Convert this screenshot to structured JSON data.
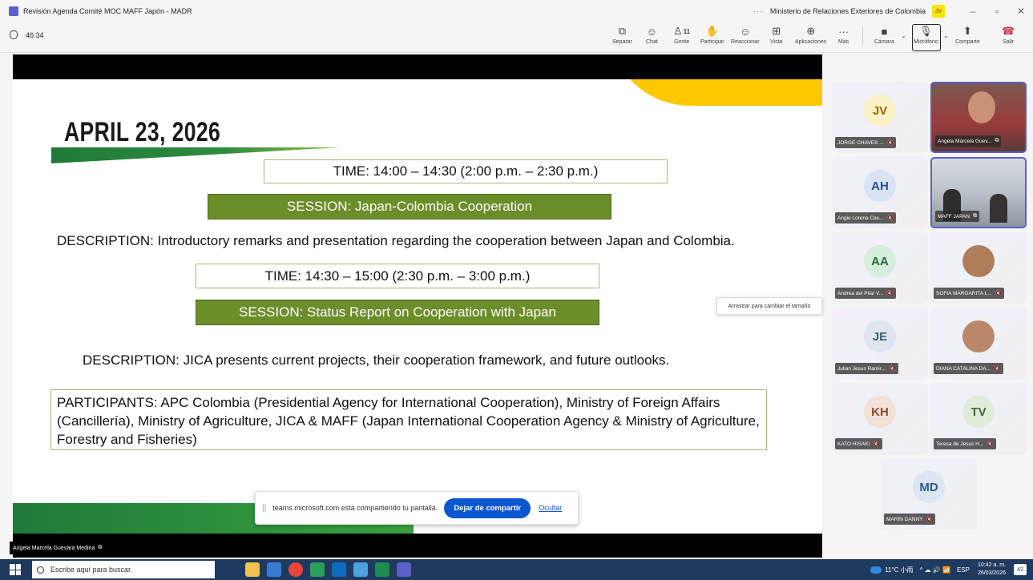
{
  "window": {
    "title": "Revisión Agenda Comité MOC MAFF Japón - MADR",
    "more": "···",
    "org": "Ministerio de Relaciones Exteriores de Colombia",
    "user_initials": "JV",
    "minimize": "–",
    "restore": "▫",
    "close": "✕"
  },
  "toolbar": {
    "timer": "46:34",
    "buttons": {
      "separar": "Separar",
      "chat": "Chat",
      "gente": "Gente",
      "gente_count": "11",
      "participar": "Participar",
      "reaccionar": "Reaccionar",
      "vista": "Vista",
      "aplicaciones": "Aplicaciones",
      "mas": "Más",
      "camara": "Cámara",
      "microfono": "Micrófono",
      "comparte": "Comparte",
      "salir": "Salir"
    }
  },
  "slide": {
    "date": "APRIL 23, 2026",
    "time1": "TIME: 14:00 – 14:30 (2:00 p.m. – 2:30 p.m.)",
    "session1": "SESSION: Japan-Colombia Cooperation",
    "desc1": "DESCRIPTION: Introductory remarks and presentation regarding the cooperation between Japan and Colombia.",
    "time2": "TIME: 14:30 – 15:00 (2:30 p.m. – 3:00 p.m.)",
    "session2": "SESSION: Status Report on Cooperation with Japan",
    "desc2": "DESCRIPTION: JICA presents current projects, their cooperation framework, and future outlooks.",
    "participants": "PARTICIPANTS: APC Colombia (Presidential Agency for International Cooperation), Ministry of Foreign Affairs (Cancillería), Ministry of Agriculture, JICA & MAFF (Japan International Cooperation Agency & Ministry of Agriculture, Forestry and Fisheries)",
    "colors": {
      "session_bg": "#6b8e2a",
      "accent_yellow": "#fdc800",
      "green": "#1f7a3a"
    }
  },
  "share_bar": {
    "grip": "||",
    "message": "teams.microsoft.com está compartiendo tu pantalla.",
    "stop": "Dejar de compartir",
    "hide": "Ocultar"
  },
  "presenter_label": "Angela Marcela Guevara Medina",
  "tooltip": "Arrastrar para cambiar el tamaño",
  "participants": [
    {
      "initials": "JV",
      "name": "JORGE CHAVES ...",
      "color": "#9c6a00",
      "bg": "#fbf0c6"
    },
    {
      "name": "Angela Marcela Guev..."
    },
    {
      "initials": "AH",
      "name": "Angie Lorena Cas...",
      "color": "#2a4f8f",
      "bg": "#d9e3f4"
    },
    {
      "name": "MAFF JAPAN"
    },
    {
      "initials": "AA",
      "name": "Andrea del Pilar V...",
      "color": "#23703a",
      "bg": "#d6eedb"
    },
    {
      "name": "SOFIA MARGARITA L..."
    },
    {
      "initials": "JE",
      "name": "Julian Jesus Ramir...",
      "color": "#3e5c75",
      "bg": "#dde6ee"
    },
    {
      "name": "DIANA CATALINA DA..."
    },
    {
      "initials": "KH",
      "name": "KATO HISAKI",
      "color": "#8a4b2f",
      "bg": "#f1e1d6"
    },
    {
      "initials": "TV",
      "name": "Teresa de Jesus H...",
      "color": "#3f6b3a",
      "bg": "#e0ecd9"
    },
    {
      "initials": "MD",
      "name": "MARIN DANNY",
      "color": "#2f5b8a",
      "bg": "#dbe6f2"
    }
  ],
  "taskbar": {
    "search_placeholder": "Escribe aquí para buscar.",
    "weather": "11°C 小雨",
    "lang": "ESP",
    "time": "10:42 a. m.",
    "date": "26/03/2026",
    "notifications": "42"
  }
}
